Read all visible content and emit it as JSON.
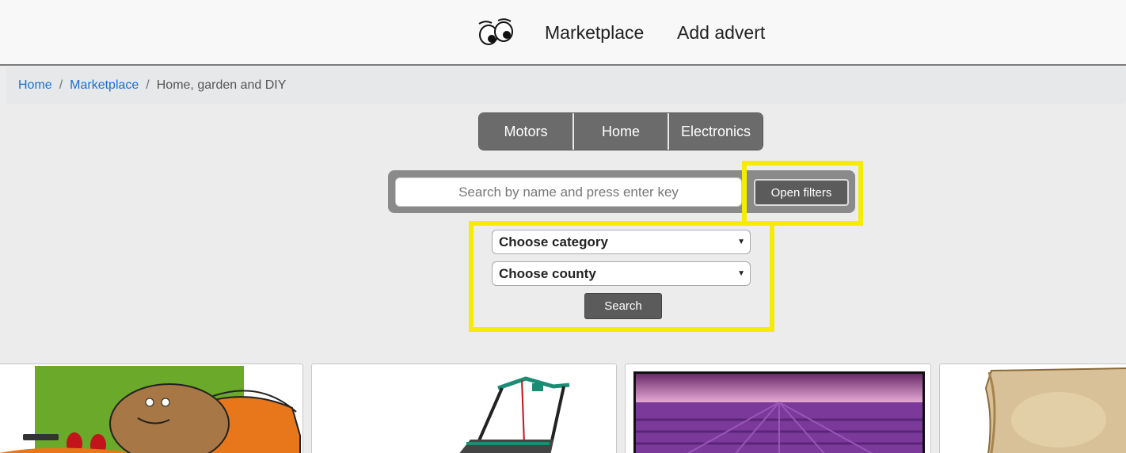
{
  "header": {
    "logo_icon": "eyes-icon",
    "nav": [
      {
        "label": "Marketplace"
      },
      {
        "label": "Add advert"
      }
    ]
  },
  "breadcrumb": {
    "items": [
      {
        "label": "Home",
        "link": true
      },
      {
        "label": "Marketplace",
        "link": true
      },
      {
        "label": "Home, garden and DIY",
        "link": false
      }
    ],
    "separator": "/"
  },
  "category_tabs": [
    {
      "label": "Motors"
    },
    {
      "label": "Home"
    },
    {
      "label": "Electronics"
    }
  ],
  "search": {
    "placeholder": "Search by name and press enter key",
    "value": "",
    "open_filters_label": "Open filters"
  },
  "filters": {
    "category_select": "Choose category",
    "county_select": "Choose county",
    "search_label": "Search"
  },
  "listings": [
    {
      "image": "couch-potato-cartoon"
    },
    {
      "image": "lawn-mower"
    },
    {
      "image": "lavender-field-tv"
    },
    {
      "image": "parchment-paper"
    }
  ],
  "colors": {
    "highlight": "#f5ec00",
    "link": "#1a6fd6",
    "button": "#5b5b5b",
    "tab": "#6b6b6b"
  }
}
